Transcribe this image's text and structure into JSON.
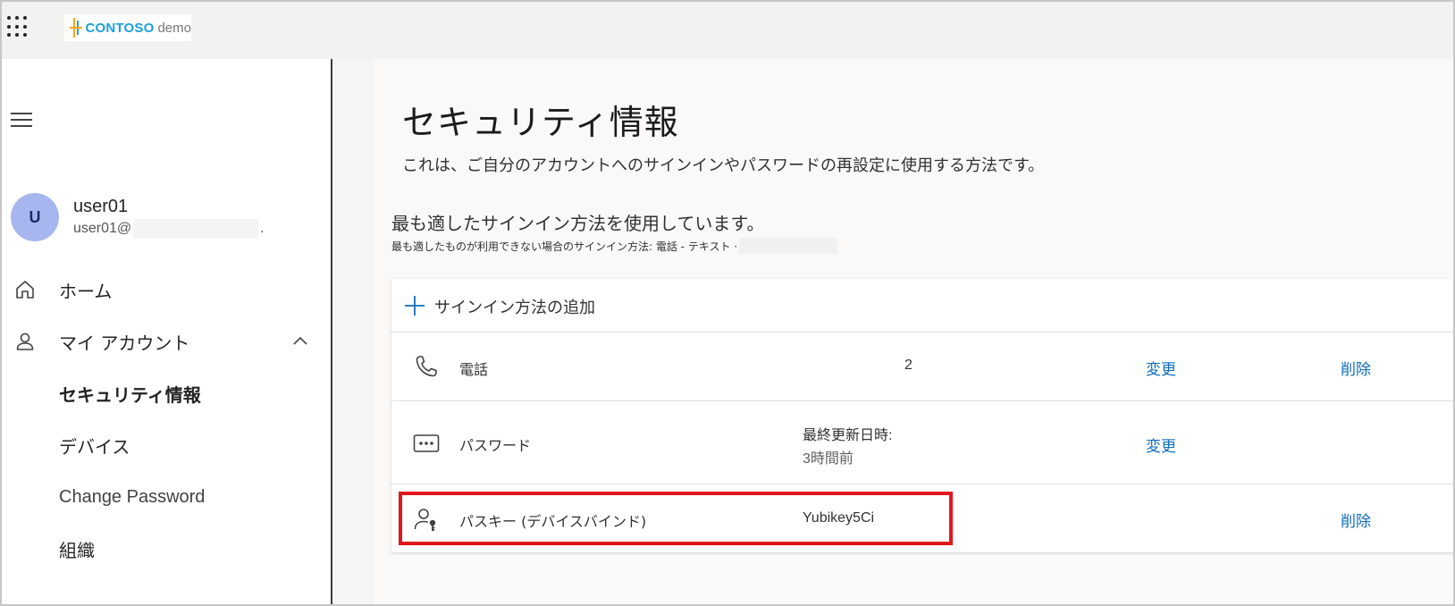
{
  "brand": {
    "name": "CONTOSO",
    "suffix": "demo"
  },
  "user": {
    "initial": "U",
    "name": "user01",
    "email_prefix": "user01@",
    "email_suffix": "."
  },
  "nav": {
    "home": "ホーム",
    "my_account": "マイ アカウント",
    "security_info": "セキュリティ情報",
    "devices": "デバイス",
    "change_password": "Change Password",
    "organizations": "組織"
  },
  "page": {
    "title": "セキュリティ情報",
    "description": "これは、ご自分のアカウントへのサインインやパスワードの再設定に使用する方法です。",
    "best_method_title": "最も適したサインイン方法を使用しています。",
    "best_method_fallback": "最も適したものが利用できない場合のサインイン方法: 電話 - テキスト ·"
  },
  "methods": {
    "add_label": "サインイン方法の追加",
    "phone": {
      "name": "電話",
      "detail": "2",
      "change": "変更",
      "delete": "削除"
    },
    "password": {
      "name": "パスワード",
      "detail_label": "最終更新日時:",
      "detail_value": "3時間前",
      "change": "変更"
    },
    "passkey": {
      "name": "パスキー (デバイスバインド)",
      "detail": "Yubikey5Ci",
      "delete": "削除"
    }
  },
  "colors": {
    "link": "#0f6cbd",
    "highlight": "#e3161b",
    "avatar": "#a7b6ee",
    "brand": "#1aa0db"
  }
}
